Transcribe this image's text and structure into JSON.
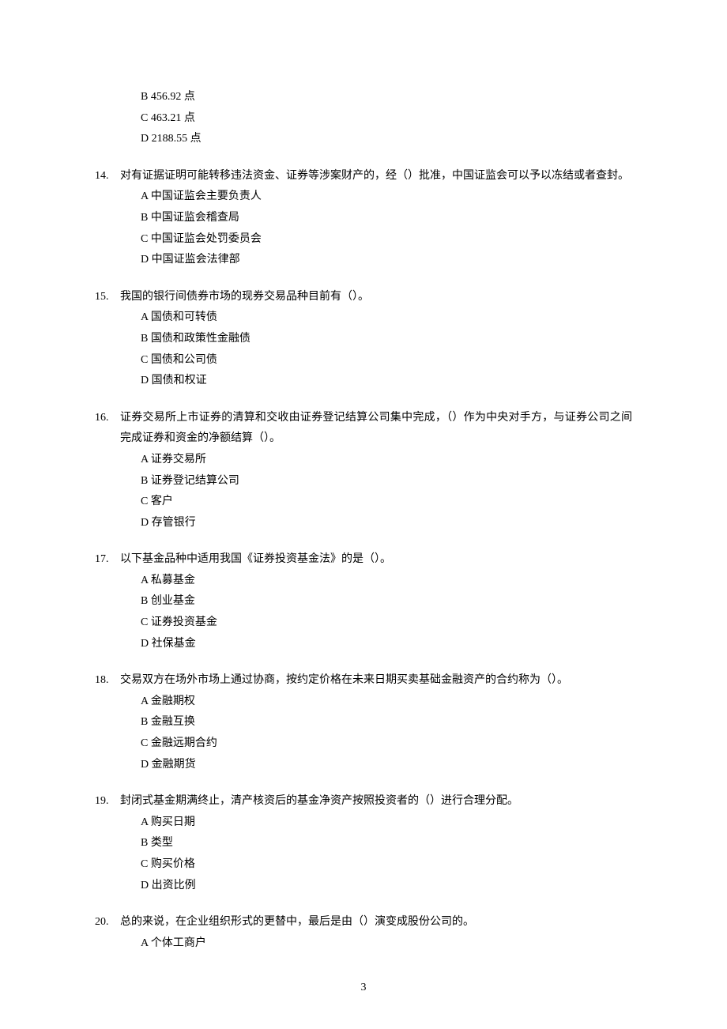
{
  "orphan": {
    "options": [
      "B 456.92 点",
      "C 463.21 点",
      "D 2188.55 点"
    ]
  },
  "questions": [
    {
      "num": "14.",
      "stem": "对有证据证明可能转移违法资金、证券等涉案财产的，经（）批准，中国证监会可以予以冻结或者查封。",
      "options": [
        "A 中国证监会主要负责人",
        "B 中国证监会稽查局",
        "C 中国证监会处罚委员会",
        "D 中国证监会法律部"
      ]
    },
    {
      "num": "15.",
      "stem": "我国的银行间债券市场的现券交易品种目前有（）。",
      "options": [
        "A 国债和可转债",
        "B 国债和政策性金融债",
        "C 国债和公司债",
        "D 国债和权证"
      ]
    },
    {
      "num": "16.",
      "stem": "证券交易所上市证券的清算和交收由证券登记结算公司集中完成，（）作为中央对手方，与证券公司之间完成证券和资金的净额结算（）。",
      "options": [
        "A 证券交易所",
        "B 证券登记结算公司",
        "C 客户",
        "D 存管银行"
      ]
    },
    {
      "num": "17.",
      "stem": "以下基金品种中适用我国《证券投资基金法》的是（）。",
      "options": [
        "A 私募基金",
        "B 创业基金",
        "C 证券投资基金",
        "D 社保基金"
      ]
    },
    {
      "num": "18.",
      "stem": "交易双方在场外市场上通过协商，按约定价格在未来日期买卖基础金融资产的合约称为（）。",
      "options": [
        "A 金融期权",
        "B 金融互换",
        "C 金融远期合约",
        "D 金融期货"
      ]
    },
    {
      "num": "19.",
      "stem": "封闭式基金期满终止，清产核资后的基金净资产按照投资者的（）进行合理分配。",
      "options": [
        "A 购买日期",
        "B 类型",
        "C 购买价格",
        "D 出资比例"
      ]
    },
    {
      "num": "20.",
      "stem": "总的来说，在企业组织形式的更替中，最后是由（）演变成股份公司的。",
      "options": [
        "A 个体工商户"
      ]
    }
  ],
  "pageNumber": "3"
}
